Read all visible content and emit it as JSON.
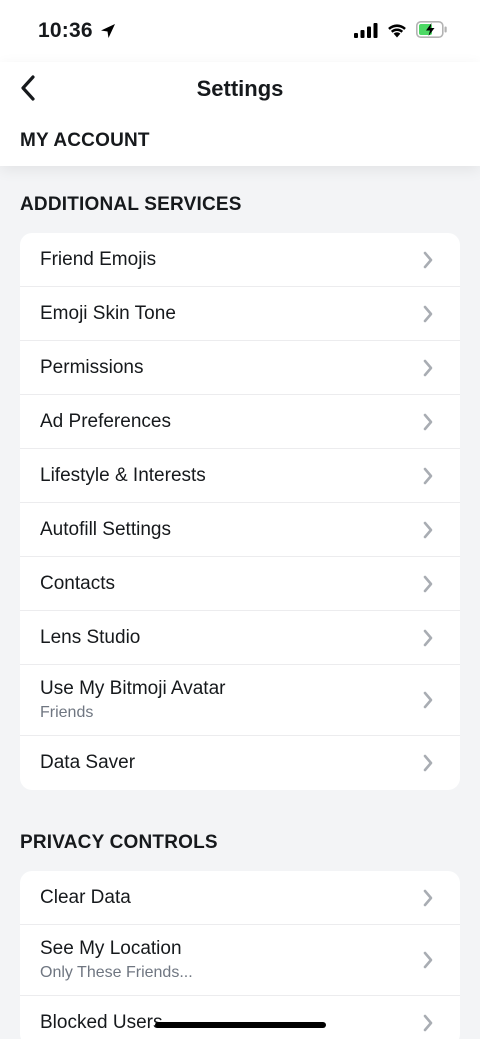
{
  "status_bar": {
    "time": "10:36",
    "icons": [
      "location-arrow-icon",
      "cellular-signal-icon",
      "wifi-icon",
      "battery-charging-icon"
    ],
    "battery_color": "#4cd964"
  },
  "header": {
    "title": "Settings",
    "back_icon": "chevron-left-icon",
    "my_account": "MY ACCOUNT"
  },
  "additional_services": {
    "title": "ADDITIONAL SERVICES",
    "items": [
      {
        "label": "Friend Emojis"
      },
      {
        "label": "Emoji Skin Tone"
      },
      {
        "label": "Permissions"
      },
      {
        "label": "Ad Preferences"
      },
      {
        "label": "Lifestyle & Interests"
      },
      {
        "label": "Autofill Settings"
      },
      {
        "label": "Contacts"
      },
      {
        "label": "Lens Studio"
      },
      {
        "label": "Use My Bitmoji Avatar",
        "sub": "Friends"
      },
      {
        "label": "Data Saver"
      }
    ]
  },
  "privacy_controls": {
    "title": "PRIVACY CONTROLS",
    "items": [
      {
        "label": "Clear Data"
      },
      {
        "label": "See My Location",
        "sub": "Only These Friends..."
      },
      {
        "label": "Blocked Users"
      }
    ]
  },
  "colors": {
    "background": "#f3f4f6",
    "card": "#ffffff",
    "text": "#16191c",
    "subtext": "#6f7681",
    "chevron": "#a9adb3"
  }
}
